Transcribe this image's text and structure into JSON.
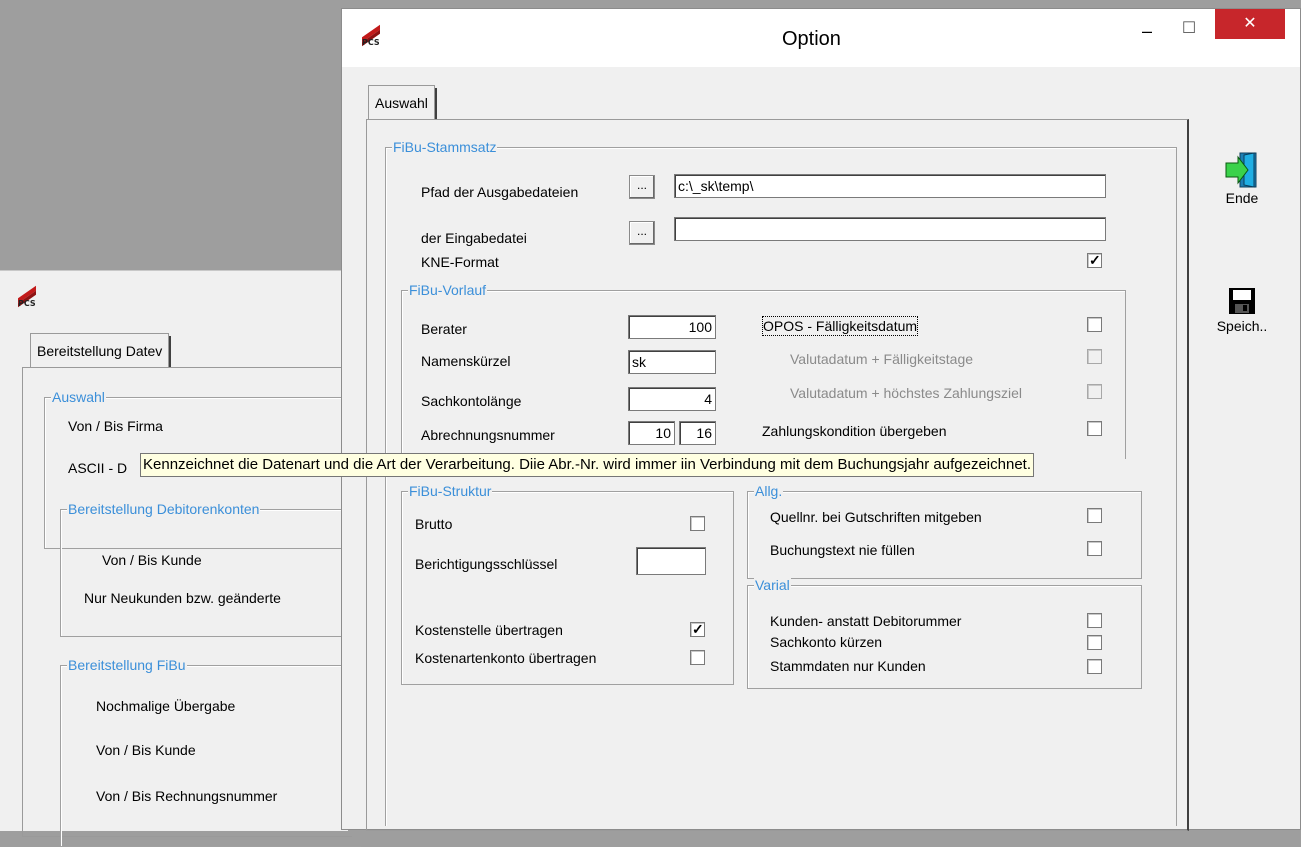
{
  "colors": {
    "group_label": "#3b8fd9",
    "close_button": "#c7262b",
    "tooltip_bg": "#ffffe1"
  },
  "background_window": {
    "logo_text": "PCS",
    "tab": "Bereitstellung Datev",
    "auswahl": {
      "title": "Auswahl",
      "von_bis_firma": "Von / Bis Firma",
      "ascii": "ASCII - D"
    },
    "debitoren": {
      "title": "Bereitstellung Debitorenkonten",
      "von_bis_kunde": "Von / Bis Kunde",
      "neukunden": "Nur Neukunden bzw. geänderte"
    },
    "fibu": {
      "title": "Bereitstellung FiBu",
      "nochmalige": "Nochmalige Übergabe",
      "von_bis_kunde": "Von / Bis Kunde",
      "von_bis_rechnung": "Von / Bis Rechnungsnummer"
    }
  },
  "dialog": {
    "title": "Option",
    "logo_text": "PCS",
    "controls": {
      "minimize": "–",
      "maximize": "☐",
      "close": "✕"
    },
    "tab": "Auswahl",
    "stammsatz": {
      "title": "FiBu-Stammsatz",
      "ausgabe_label": "Pfad der Ausgabedateien",
      "ausgabe_value": "c:\\_sk\\temp\\",
      "eingabe_label": "der Eingabedatei",
      "eingabe_value": "",
      "browse_label": "...",
      "kne_label": "KNE-Format",
      "kne_checked": true
    },
    "vorlauf": {
      "title": "FiBu-Vorlauf",
      "berater_label": "Berater",
      "berater_value": "100",
      "namens_label": "Namenskürzel",
      "namens_value": "sk",
      "sachkonto_label": "Sachkontolänge",
      "sachkonto_value": "4",
      "abrechnung_label": "Abrechnungsnummer",
      "abrechnung_value1": "10",
      "abrechnung_value2": "16",
      "opos_label": "OPOS - Fälligkeitsdatum",
      "valuta1_label": "Valutadatum + Fälligkeitstage",
      "valuta2_label": "Valutadatum + höchstes Zahlungsziel",
      "zahlung_label": "Zahlungskondition übergeben"
    },
    "struktur": {
      "title": "FiBu-Struktur",
      "brutto_label": "Brutto",
      "brutto_checked": false,
      "berichtigung_label": "Berichtigungsschlüssel",
      "berichtigung_value": "",
      "kostenstelle_label": "Kostenstelle übertragen",
      "kostenstelle_checked": true,
      "kostenarten_label": "Kostenartenkonto übertragen",
      "kostenarten_checked": false
    },
    "allg": {
      "title": "Allg.",
      "quell_label": "Quellnr. bei Gutschriften mitgeben",
      "buchung_label": "Buchungstext nie füllen"
    },
    "varial": {
      "title": "Varial",
      "kunden_label": "Kunden- anstatt Debitorummer",
      "sachkonto_label": "Sachkonto kürzen",
      "stammdaten_label": "Stammdaten nur Kunden"
    },
    "toolbar": {
      "ende_label": "Ende",
      "speich_label": "Speich.."
    },
    "check_mark": "✓"
  },
  "tooltip": "Kennzeichnet die Datenart und die Art der Verarbeitung. Diie Abr.-Nr. wird immer iin Verbindung mit dem Buchungsjahr aufgezeichnet."
}
